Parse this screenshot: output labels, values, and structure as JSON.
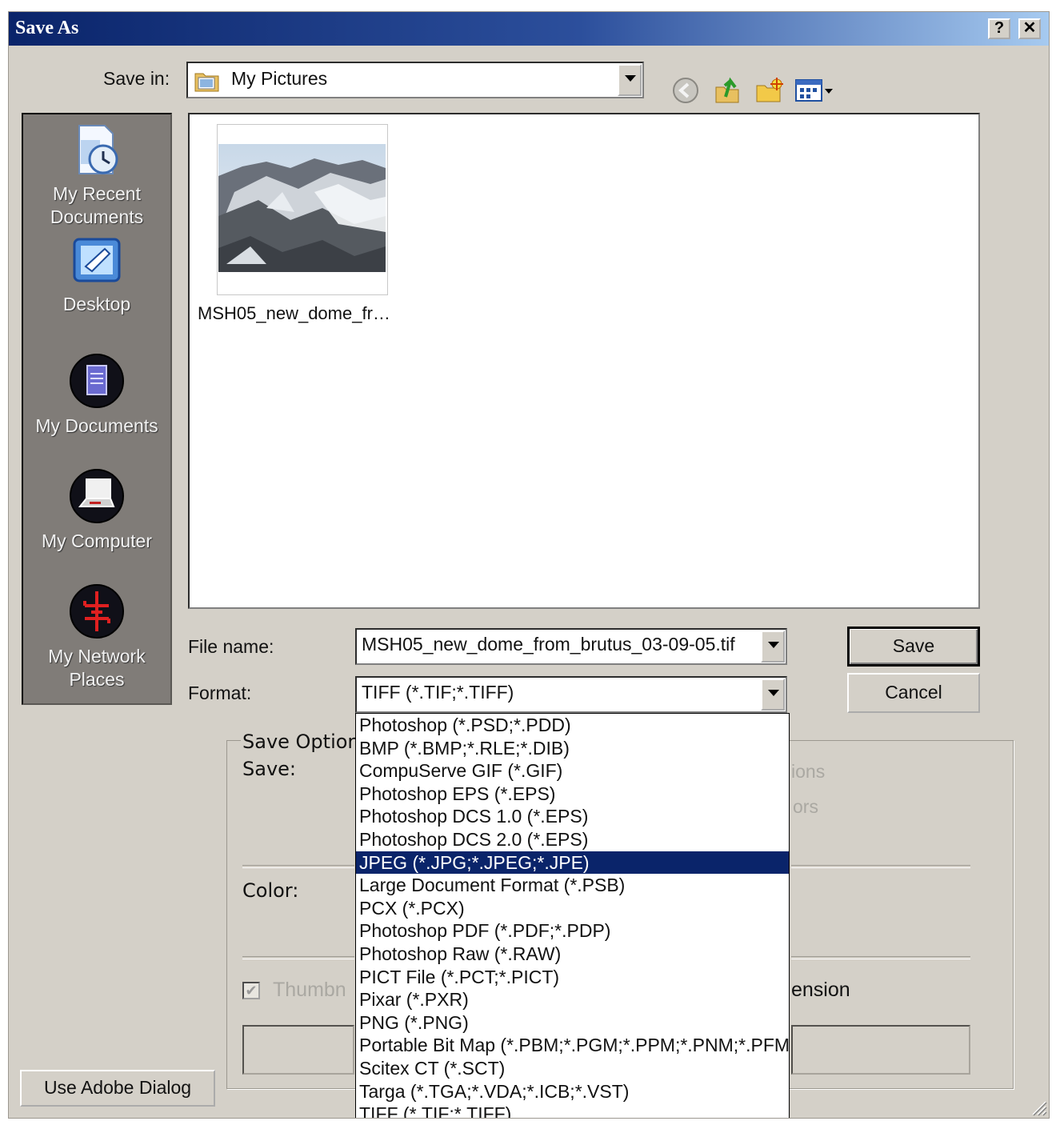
{
  "window": {
    "title": "Save As",
    "help_button": "?",
    "close_button": "✕"
  },
  "toolbar": {
    "save_in_label": "Save in:",
    "save_in_value": "My Pictures",
    "icons": [
      "back-icon",
      "up-folder-icon",
      "new-folder-icon",
      "views-menu-icon"
    ]
  },
  "places_bar": {
    "items": [
      {
        "label_line1": "My Recent",
        "label_line2": "Documents",
        "icon": "recent-documents-icon"
      },
      {
        "label_line1": "Desktop",
        "label_line2": "",
        "icon": "desktop-icon"
      },
      {
        "label_line1": "My Documents",
        "label_line2": "",
        "icon": "my-documents-icon"
      },
      {
        "label_line1": "My Computer",
        "label_line2": "",
        "icon": "my-computer-icon"
      },
      {
        "label_line1": "My Network",
        "label_line2": "Places",
        "icon": "network-places-icon"
      }
    ]
  },
  "file_list": {
    "items": [
      {
        "name": "MSH05_new_dome_fr…",
        "type": "image-thumbnail"
      }
    ]
  },
  "form": {
    "file_name_label": "File name:",
    "file_name_value": "MSH05_new_dome_from_brutus_03-09-05.tif",
    "format_label": "Format:",
    "format_value": "TIFF (*.TIF;*.TIFF)",
    "save_button": "Save",
    "cancel_button": "Cancel"
  },
  "save_options": {
    "group_title": "Save Option",
    "save_label": "Save:",
    "color_label": "Color:",
    "partial_right_1": "ions",
    "partial_right_2": "ors",
    "thumbnail_partial": "Thumbn",
    "thumbnail_checked": true,
    "extension_partial": "ension"
  },
  "format_dropdown": {
    "selected_index": 6,
    "options": [
      "Photoshop (*.PSD;*.PDD)",
      "BMP (*.BMP;*.RLE;*.DIB)",
      "CompuServe GIF (*.GIF)",
      "Photoshop EPS (*.EPS)",
      "Photoshop DCS 1.0 (*.EPS)",
      "Photoshop DCS 2.0 (*.EPS)",
      "JPEG (*.JPG;*.JPEG;*.JPE)",
      "Large Document Format (*.PSB)",
      "PCX (*.PCX)",
      "Photoshop PDF (*.PDF;*.PDP)",
      "Photoshop Raw (*.RAW)",
      "PICT File (*.PCT;*.PICT)",
      "Pixar (*.PXR)",
      "PNG (*.PNG)",
      "Portable Bit Map (*.PBM;*.PGM;*.PPM;*.PNM;*.PFM",
      "Scitex CT (*.SCT)",
      "Targa (*.TGA;*.VDA;*.ICB;*.VST)",
      "TIFF (*.TIF;*.TIFF)"
    ]
  },
  "footer": {
    "adobe_dialog_button": "Use Adobe Dialog"
  }
}
